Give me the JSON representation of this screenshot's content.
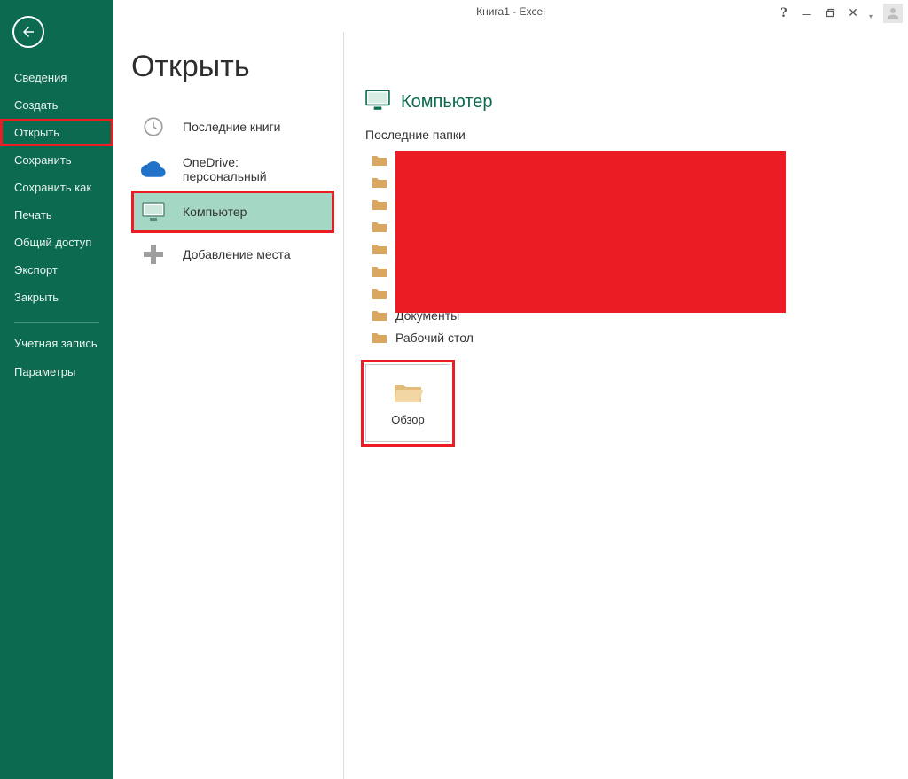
{
  "titlebar": {
    "title": "Книга1 - Excel"
  },
  "sidebar": {
    "items": [
      {
        "label": "Сведения"
      },
      {
        "label": "Создать"
      },
      {
        "label": "Открыть"
      },
      {
        "label": "Сохранить"
      },
      {
        "label": "Сохранить как"
      },
      {
        "label": "Печать"
      },
      {
        "label": "Общий доступ"
      },
      {
        "label": "Экспорт"
      },
      {
        "label": "Закрыть"
      }
    ],
    "footer": [
      {
        "label": "Учетная запись"
      },
      {
        "label": "Параметры"
      }
    ]
  },
  "page": {
    "title": "Открыть"
  },
  "places": {
    "recent": {
      "label": "Последние книги"
    },
    "onedrive": {
      "label": "OneDrive: персональный"
    },
    "computer": {
      "label": "Компьютер"
    },
    "add": {
      "label": "Добавление места"
    }
  },
  "right": {
    "header": "Компьютер",
    "subheader": "Последние папки",
    "folders": [
      {
        "label": ""
      },
      {
        "label": ""
      },
      {
        "label": ""
      },
      {
        "label": ""
      },
      {
        "label": ""
      },
      {
        "label": ""
      },
      {
        "label": ""
      },
      {
        "label": "Документы"
      },
      {
        "label": "Рабочий стол"
      }
    ],
    "browse": "Обзор"
  }
}
